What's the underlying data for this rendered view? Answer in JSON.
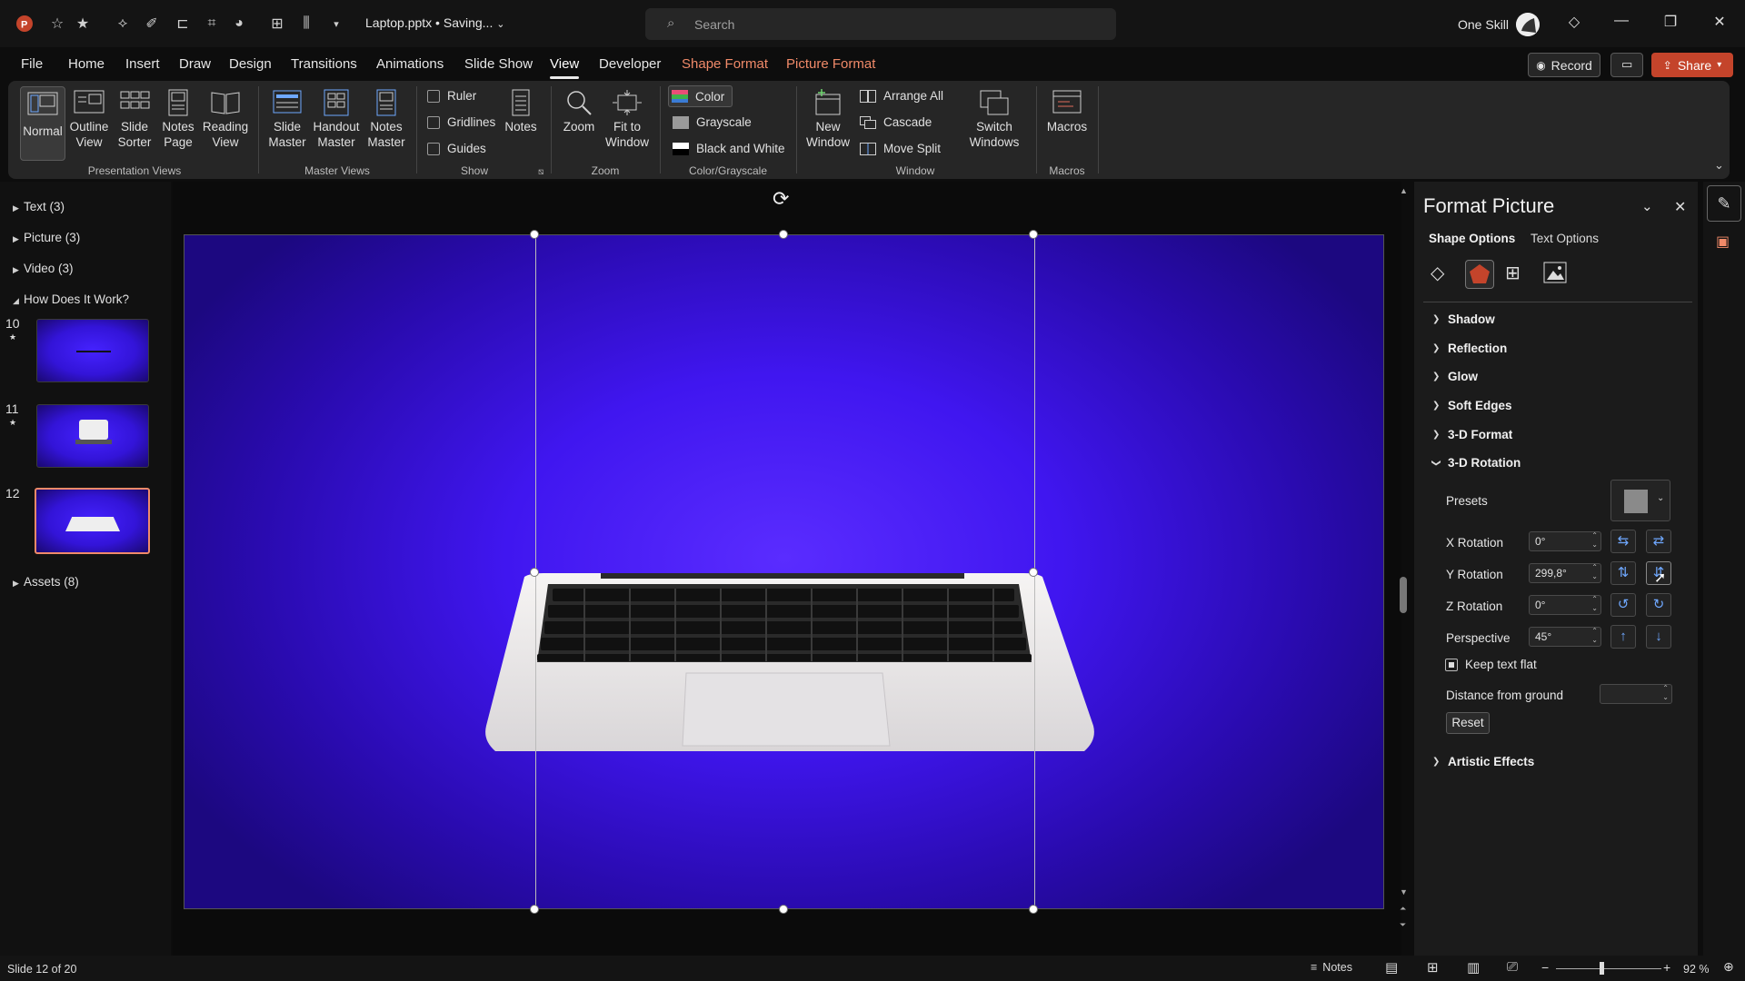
{
  "titlebar": {
    "filename": "Laptop.pptx • Saving...",
    "search_placeholder": "Search",
    "user": "One Skill"
  },
  "menu": {
    "tabs": [
      "File",
      "Home",
      "Insert",
      "Draw",
      "Design",
      "Transitions",
      "Animations",
      "Slide Show",
      "View",
      "Developer",
      "Shape Format",
      "Picture Format"
    ],
    "active": "View",
    "record_label": "Record",
    "share_label": "Share"
  },
  "ribbon": {
    "presentation_views": {
      "label": "Presentation Views",
      "normal": "Normal",
      "outline": "Outline\nView",
      "sorter": "Slide\nSorter",
      "notes_page": "Notes\nPage",
      "reading": "Reading\nView"
    },
    "master_views": {
      "label": "Master Views",
      "slide_master": "Slide\nMaster",
      "handout_master": "Handout\nMaster",
      "notes_master": "Notes\nMaster"
    },
    "show": {
      "label": "Show",
      "ruler": "Ruler",
      "gridlines": "Gridlines",
      "guides": "Guides",
      "notes": "Notes"
    },
    "zoom": {
      "label": "Zoom",
      "zoom": "Zoom",
      "fit": "Fit to\nWindow"
    },
    "color": {
      "label": "Color/Grayscale",
      "color": "Color",
      "grayscale": "Grayscale",
      "bw": "Black and White"
    },
    "window": {
      "label": "Window",
      "new_window": "New\nWindow",
      "arrange_all": "Arrange All",
      "cascade": "Cascade",
      "move_split": "Move Split",
      "switch": "Switch\nWindows"
    },
    "macros": {
      "label": "Macros",
      "macros": "Macros"
    }
  },
  "outline": {
    "sections": [
      {
        "label": "Text (3)"
      },
      {
        "label": "Picture (3)"
      },
      {
        "label": "Video (3)"
      },
      {
        "label": "How Does It Work?"
      }
    ],
    "slides": [
      {
        "num": "10"
      },
      {
        "num": "11"
      },
      {
        "num": "12"
      }
    ],
    "assets": "Assets (8)"
  },
  "pane": {
    "title": "Format Picture",
    "tab_shape": "Shape Options",
    "tab_text": "Text Options",
    "sections": [
      "Shadow",
      "Reflection",
      "Glow",
      "Soft Edges",
      "3-D Format",
      "3-D Rotation"
    ],
    "presets_label": "Presets",
    "x_label": "X Rotation",
    "x_value": "0°",
    "y_label": "Y Rotation",
    "y_value": "299,8°",
    "z_label": "Z Rotation",
    "z_value": "0°",
    "perspective_label": "Perspective",
    "perspective_value": "45°",
    "keep_flat": "Keep text flat",
    "distance_label": "Distance from ground",
    "reset": "Reset",
    "artistic": "Artistic Effects"
  },
  "status": {
    "slide_info": "Slide 12 of 20",
    "notes": "Notes",
    "zoom": "92 %"
  },
  "colors": {
    "accent": "#c4442b",
    "context_tab": "#f08a69",
    "slide_bg": "#4016f0"
  }
}
